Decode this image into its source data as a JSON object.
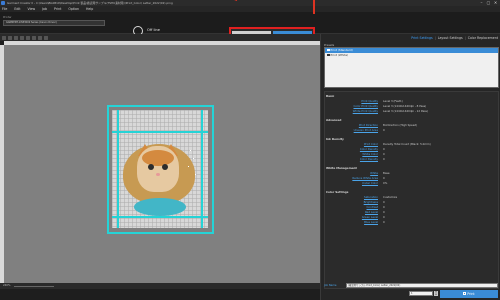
{
  "window": {
    "title": "Garment Creator II - C:\\Users\\BG0810\\Desktop\\Print 製品/確認用サンプル(TSHU素材用)(Print_Color) Letter_2022(02).prng",
    "controls": [
      "–",
      "▢",
      "✕"
    ]
  },
  "menu": [
    "File",
    "Edit",
    "View",
    "Job",
    "Print",
    "Option",
    "Help"
  ],
  "header": {
    "printer_label": "Printer",
    "printer_value": "GARMENT-GT-B3000 Series (Canon Driver)",
    "power_label": "Off line",
    "view_toggle": {
      "simple_label": "Simple",
      "print_label": "Print",
      "active": "print"
    }
  },
  "right_panel": {
    "tabs": [
      {
        "label": "Print Settings",
        "active": true
      },
      {
        "label": "Layout Settings",
        "active": false
      },
      {
        "label": "Color Replacement",
        "active": false
      }
    ],
    "presets_label": "Presets",
    "presets": [
      {
        "label": "Print (Standard)",
        "selected": true
      },
      {
        "label": "Print (White)",
        "selected": false
      }
    ],
    "sections": {
      "basic": {
        "title": "Basic",
        "rows": [
          {
            "label": "Print Quality",
            "value": "Level 3 (Fast1)"
          },
          {
            "label": "Color Print Quality",
            "value": "Level 3 (1440x1440dpi - 8 Pass)"
          },
          {
            "label": "White Print Quality",
            "value": "Level 3 (1440x1440dpi - 12 Pass)"
          }
        ]
      },
      "advanced": {
        "title": "Advanced",
        "rows": [
          {
            "label": "Print Direction",
            "value": "Bi-Direction (High Speed)"
          },
          {
            "label": "Uneven Print Area",
            "value": "0"
          }
        ]
      },
      "ink_density": {
        "title": "Ink Density",
        "rows": [
          {
            "label": "Print Color",
            "value": "Density Total Count (Black: 5.0mm)"
          },
          {
            "label": "Color Density",
            "value": "0"
          },
          {
            "label": "White Color",
            "value": "0"
          },
          {
            "label": "Color Density",
            "value": "0"
          }
        ]
      },
      "white_management": {
        "title": "White Management",
        "rows": [
          {
            "label": "White",
            "value": "Base"
          },
          {
            "label": "Reduce White Area",
            "value": "0"
          },
          {
            "label": "Under Color",
            "value": "0%"
          }
        ]
      },
      "color_settings": {
        "title": "Color Settings",
        "rows": [
          {
            "label": "Saturation",
            "value": "Customize"
          },
          {
            "label": "Brightness",
            "value": "0"
          },
          {
            "label": "Contrast",
            "value": "0"
          },
          {
            "label": "Red Level",
            "value": "0"
          },
          {
            "label": "Green Level",
            "value": "0"
          },
          {
            "label": "Blue Level",
            "value": "0"
          }
        ]
      }
    },
    "job": {
      "label": "Job Name",
      "value": "(確認用サンプル Print_Color) Letter_2022(02)",
      "copies": "1",
      "print_label": "Print"
    }
  },
  "status": {
    "zoom": "240%"
  },
  "colors": {
    "accent": "#3a8cd6",
    "frame": "#25d3d6",
    "highlight": "#e02020"
  }
}
